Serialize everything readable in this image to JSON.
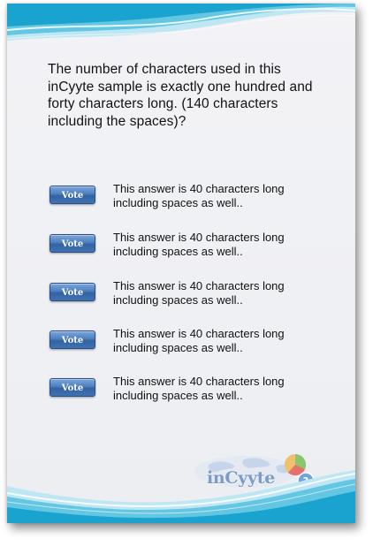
{
  "poll": {
    "question": "The number of characters used in this inCyyte sample  is exactly  one hundred and forty characters long. (140 characters including the spaces)?",
    "answers": [
      {
        "vote_label": "Vote",
        "text": "This answer is 40 characters long including spaces as well.."
      },
      {
        "vote_label": "Vote",
        "text": "This answer is 40 characters long including spaces as well.."
      },
      {
        "vote_label": "Vote",
        "text": "This answer is 40 characters long including spaces as well.."
      },
      {
        "vote_label": "Vote",
        "text": "This answer is 40 characters long including spaces as well.."
      },
      {
        "vote_label": "Vote",
        "text": "This answer is 40 characters long including spaces as well.."
      }
    ]
  },
  "branding": {
    "logo_text": "inCyyte"
  },
  "colors": {
    "wave_light": "#bfe7f3",
    "wave_mid": "#63c6e3",
    "wave_dark": "#1aa3cf",
    "vote_button": "#3f72b4",
    "logo_text": "#7d9bc7"
  }
}
